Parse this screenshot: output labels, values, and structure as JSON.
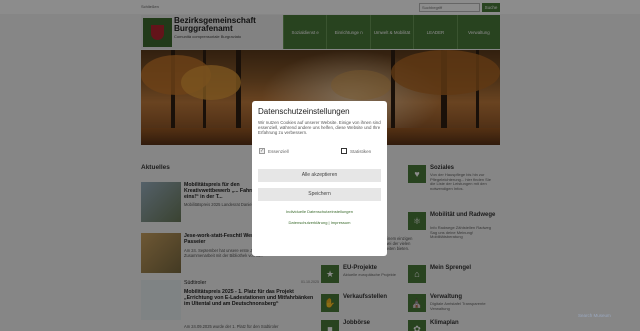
{
  "topbar": {
    "left_link": "Schließen",
    "search_placeholder": "Suchbegriff",
    "search_button": "Suche"
  },
  "header": {
    "title": "Bezirksgemeinschaft Burggrafenamt",
    "subtitle": "Comunità comprensoriale Burgraviato"
  },
  "nav": [
    "Sozialdienst e",
    "Einrichtunge n",
    "Umwelt & Mobilität",
    "LEADER",
    "Verwaltung"
  ],
  "section_title": "Aktuelles",
  "news": [
    {
      "title": "Mobilitätspreis für den Kreativwettbewerb „... Fahrrad sind eins!“ in der T...",
      "date": "",
      "text": "Mobilitätspreis 2025 Landesrat Daniel Alfreider – 1. Kategorie..."
    },
    {
      "title": "Jese-work-statt-Feschtl Werkstatt Passeier",
      "date": "01.10.2025",
      "text": "Am 24. September hat unsere erste Jese-work-statt-Feschtl, in Zusammenarbeit mit der Bibliothek von St..."
    },
    {
      "title": "Mobilitätspreis 2025 - 1. Platz für das Projekt „Errichtung von E-Ladestationen und Mitfahrbänken im Ultental und am Deutschnonsberg“",
      "date": "01.10.2025",
      "text": "Am 24.09.2025 wurde der 1. Platz für den Südtiroler"
    }
  ],
  "news_kicker": "Südtiroler",
  "tiles": [
    {
      "title": "Soziales",
      "text": "Von der Hauspflege bis hin zur Pflegeleichterung... hier finden Sie die Liste der Leistungen mit den notwendigen Infos.",
      "icon": "heart-icon"
    },
    {
      "title": "Mobilität und Radwege",
      "text": "Info Radwege Zählstellen Radweg Sag uns deine Meinung! Mobilitätsberatung",
      "icon": "bicycle-icon"
    },
    {
      "title": "EU-Projekte",
      "text": "Aktuelle europäische Projekte",
      "icon": "eu-icon"
    },
    {
      "title": "Mein Sprengel",
      "text": "",
      "icon": "home-icon"
    },
    {
      "title": "Verkaufsstellen",
      "text": "",
      "icon": "hand-icon"
    },
    {
      "title": "Verwaltung",
      "text": "Digitale Amtstafel Transparente Verwaltung",
      "icon": "building-icon"
    },
    {
      "title": "Jobbörse",
      "text": "",
      "icon": "briefcase-icon"
    },
    {
      "title": "Klimaplan",
      "text": "",
      "icon": "leaf-icon"
    }
  ],
  "mid_text": "Dienste bekommen zu einem einzigen Sammlungen und nur zwei der vielen Dienste, welche diese Seiten bieten.",
  "modal": {
    "title": "Datenschutzeinstellungen",
    "description": "Wir nutzen Cookies auf unserer Website. Einige von ihnen sind essenziell, während andere uns helfen, diese Website und Ihre Erfahrung zu verbessern.",
    "essential_label": "Essenziell",
    "statistics_label": "Statistiken",
    "accept_all": "Alle akzeptieren",
    "save": "Speichern",
    "individual_link": "Individuelle Datenschutzeinstellungen",
    "footer_links": "Datenschutzerklärung | Impressum"
  },
  "watermark": "Search Museum",
  "colors": {
    "brand_green": "#4a7a3a",
    "shield_red": "#b52630"
  }
}
